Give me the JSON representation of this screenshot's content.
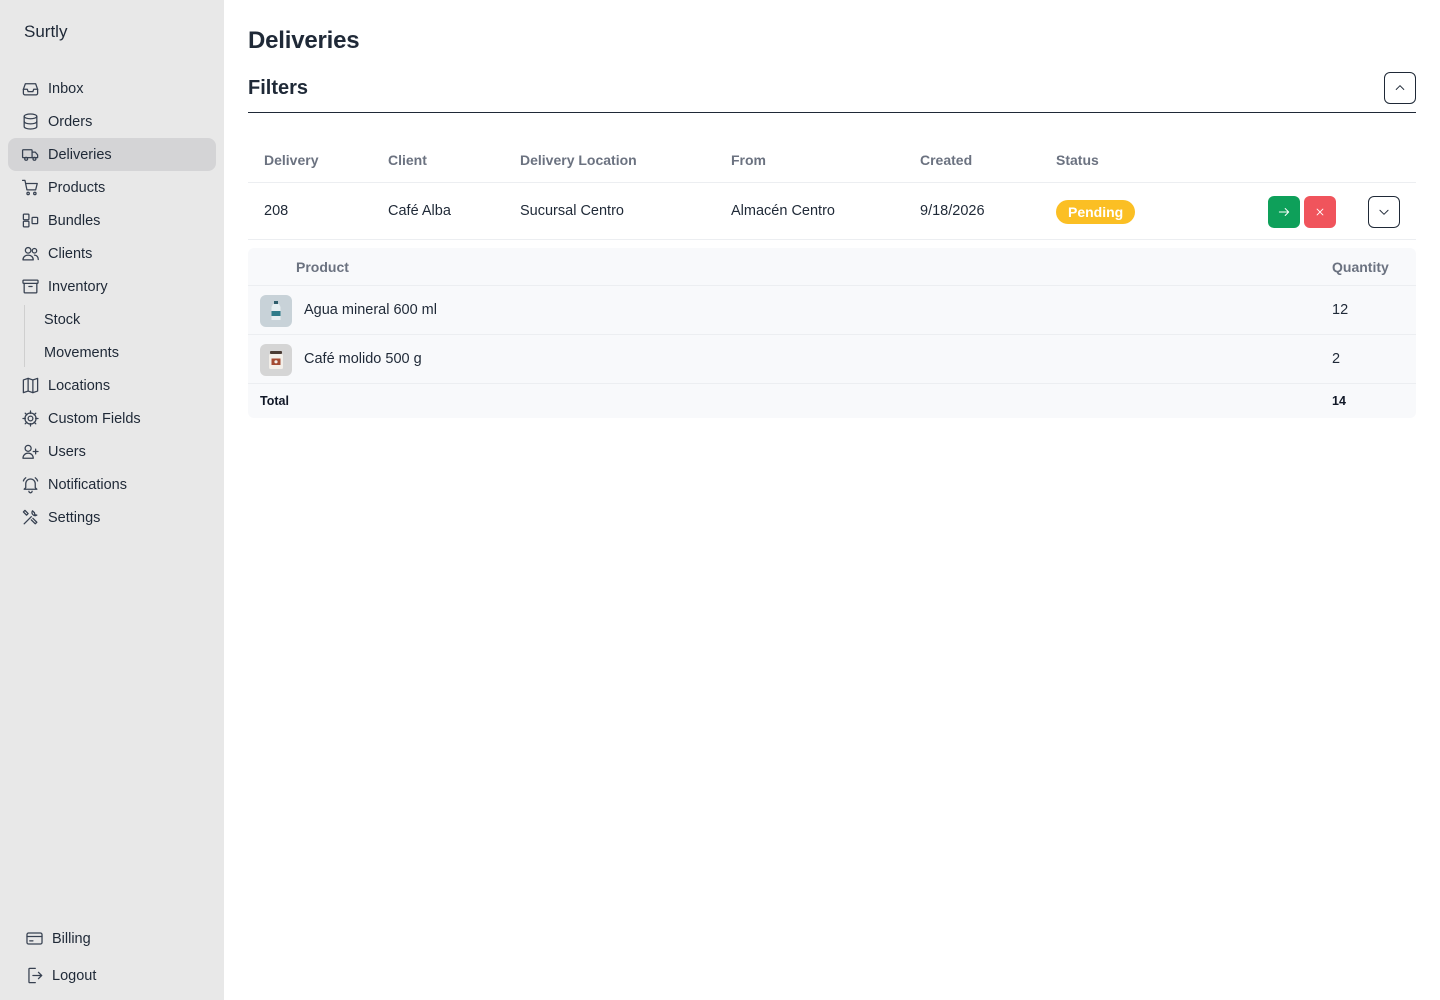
{
  "app": {
    "name": "Surtly"
  },
  "sidebar": {
    "items": [
      {
        "label": "Inbox",
        "icon": "inbox-icon"
      },
      {
        "label": "Orders",
        "icon": "database-icon"
      },
      {
        "label": "Deliveries",
        "icon": "truck-icon",
        "active": true
      },
      {
        "label": "Products",
        "icon": "cart-icon"
      },
      {
        "label": "Bundles",
        "icon": "bundle-icon"
      },
      {
        "label": "Clients",
        "icon": "users-icon"
      },
      {
        "label": "Inventory",
        "icon": "archive-icon"
      }
    ],
    "inventory_sub": [
      {
        "label": "Stock"
      },
      {
        "label": "Movements"
      }
    ],
    "items_after": [
      {
        "label": "Locations",
        "icon": "map-icon"
      },
      {
        "label": "Custom Fields",
        "icon": "cog-icon"
      },
      {
        "label": "Users",
        "icon": "user-plus-icon"
      },
      {
        "label": "Notifications",
        "icon": "bell-icon"
      },
      {
        "label": "Settings",
        "icon": "tools-icon"
      }
    ],
    "bottom": [
      {
        "label": "Billing",
        "icon": "card-icon"
      },
      {
        "label": "Logout",
        "icon": "logout-icon"
      }
    ]
  },
  "page": {
    "title": "Deliveries",
    "filters_title": "Filters"
  },
  "table": {
    "columns": [
      "Delivery",
      "Client",
      "Delivery Location",
      "From",
      "Created",
      "Status"
    ],
    "rows": [
      {
        "delivery": "208",
        "client": "Café Alba",
        "location": "Sucursal Centro",
        "from": "Almacén Centro",
        "created": "9/18/2026",
        "status": "Pending"
      }
    ]
  },
  "detail": {
    "columns": [
      "Product",
      "Quantity"
    ],
    "items": [
      {
        "name": "Agua mineral 600 ml",
        "quantity": "12",
        "icon": "water-bottle-icon"
      },
      {
        "name": "Café molido 500 g",
        "quantity": "2",
        "icon": "coffee-jar-icon"
      }
    ],
    "total_label": "Total",
    "total_value": "14"
  },
  "colors": {
    "sidebar_bg": "#e8e8e8",
    "active_item": "#d4d4d6",
    "status_pending": "#fbbf24",
    "confirm_button": "#0ea05a",
    "cancel_button": "#f0545c"
  }
}
